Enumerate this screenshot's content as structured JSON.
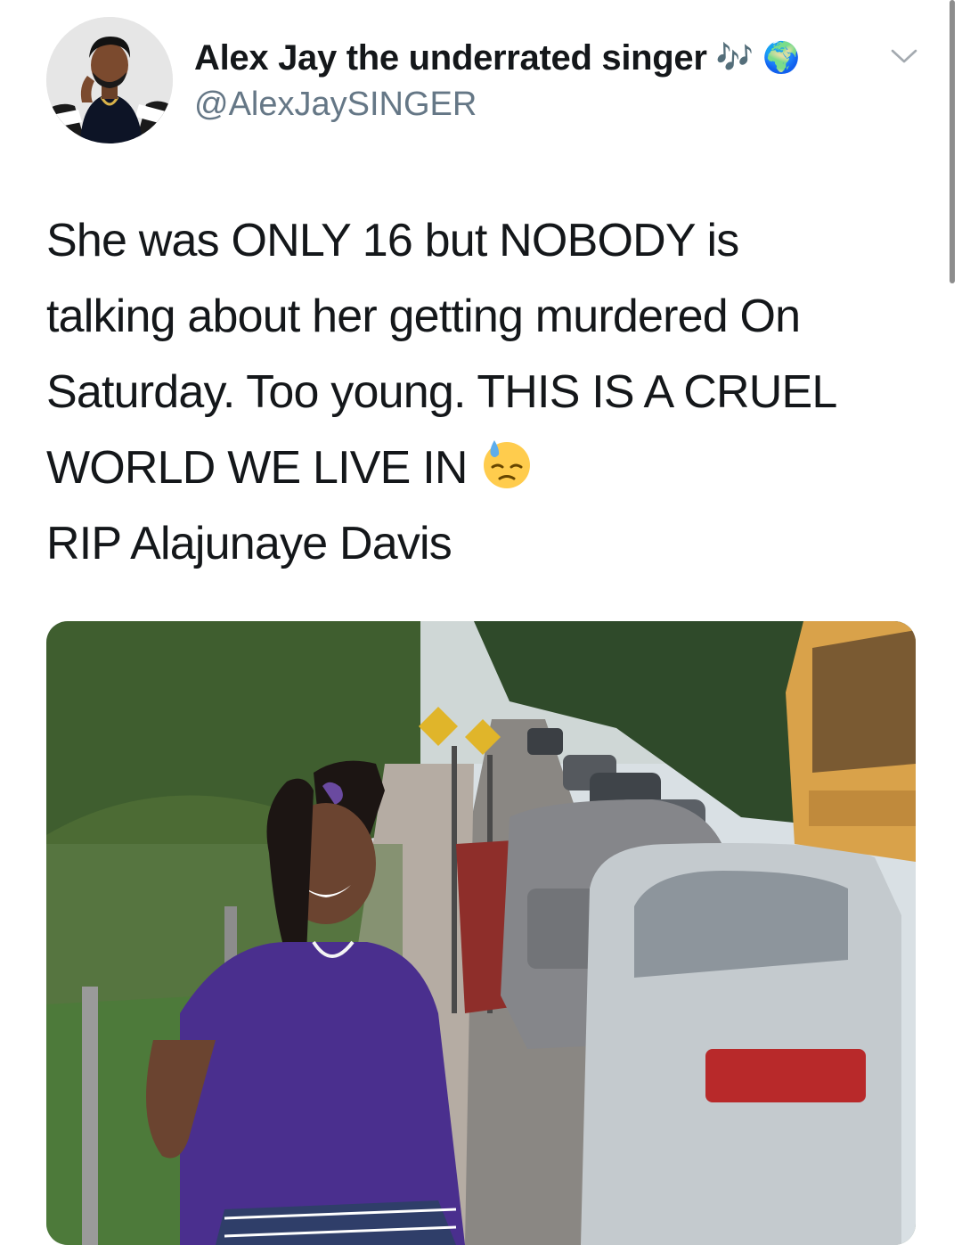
{
  "author": {
    "display_name": "Alex Jay the underrated singer",
    "name_emojis": [
      "🎶",
      "🌍"
    ],
    "handle": "@AlexJaySINGER",
    "avatar_icon": "cartoon-avatar-icon"
  },
  "tweet": {
    "lines": [
      "She was ONLY 16 but NOBODY is",
      "talking about her getting murdered On",
      "Saturday. Too young. THIS IS A CRUEL",
      "WORLD WE LIVE IN",
      "RIP Alajunaye Davis"
    ],
    "inline_emoji": "downcast-face-with-sweat-icon"
  },
  "menu": {
    "icon": "chevron-down-icon"
  },
  "colors": {
    "text": "#14171a",
    "handle": "#657786",
    "chevron": "#a4aab0",
    "scrollbar": "#8d8d8d"
  }
}
